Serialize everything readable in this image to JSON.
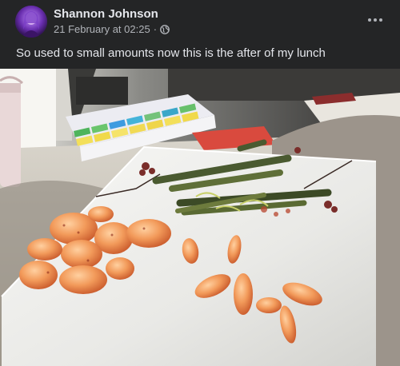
{
  "post": {
    "author": "Shannon Johnson",
    "timestamp": "21 February at 02:25",
    "separator": "·",
    "audience_icon": "globe-icon",
    "more_icon": "more-options-icon",
    "caption": "So used to small amounts now this is the after of my lunch"
  },
  "colors": {
    "background": "#242526",
    "primary_text": "#e4e6eb",
    "secondary_text": "#b0b3b8"
  }
}
